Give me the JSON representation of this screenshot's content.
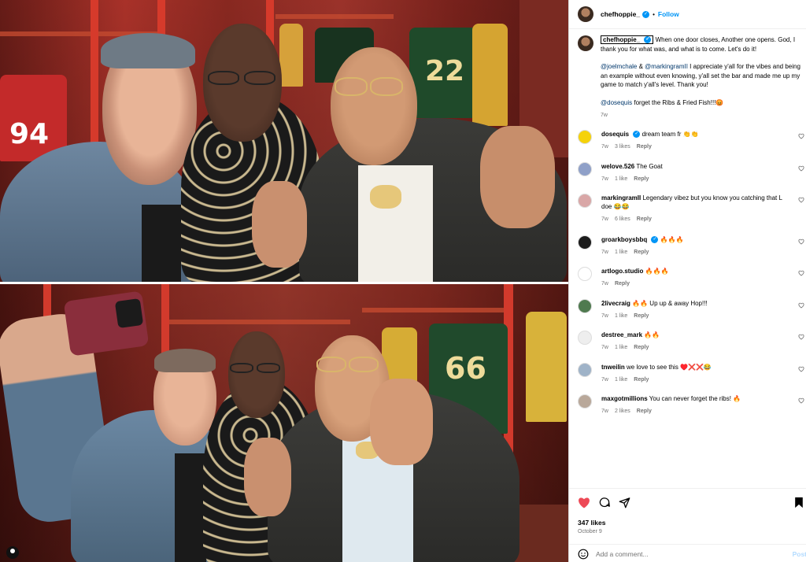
{
  "post": {
    "author": "chefhoppie_",
    "follow_label": "Follow",
    "separator": "•",
    "caption": {
      "lines": [
        "When one door closes, Another one opens. God, I thank you for what was, and what is to come. Let's do it!"
      ],
      "para2_mention1": "@joelmchale",
      "para2_amp": " & ",
      "para2_mention2": "@markingramII",
      "para2_text": " I appreciate y'all for the vibes and being an example without even knowing, y'all set the bar and made me up my game to match y'all's level. Thank you!",
      "para3_mention": "@dosequis",
      "para3_text": " forget the Ribs & Fried Fish!!!😡",
      "time": "7w"
    },
    "likes": "347 likes",
    "date": "October 9",
    "add_comment_placeholder": "Add a comment...",
    "post_label": "Post"
  },
  "comments": [
    {
      "user": "dosequis",
      "verified": true,
      "text": "dream team fr 👏👏",
      "time": "7w",
      "likes": "3 likes",
      "reply": "Reply",
      "avatar_color": "#f5d20a"
    },
    {
      "user": "welove.526",
      "verified": false,
      "text": "The Goat",
      "time": "7w",
      "likes": "1 like",
      "reply": "Reply",
      "avatar_color": "#8fa0c8"
    },
    {
      "user": "markingramII",
      "verified": false,
      "text": "Legendary vibez but you know you catching that L doe 😂😂",
      "time": "7w",
      "likes": "6 likes",
      "reply": "Reply",
      "avatar_color": "#d9a7a7"
    },
    {
      "user": "groarkboysbbq",
      "verified": true,
      "text": "🔥🔥🔥",
      "time": "7w",
      "likes": "1 like",
      "reply": "Reply",
      "avatar_color": "#1c1c1c"
    },
    {
      "user": "artlogo.studio",
      "verified": false,
      "text": "🔥🔥🔥",
      "time": "7w",
      "likes": "",
      "reply": "Reply",
      "avatar_color": "#ffffff"
    },
    {
      "user": "2livecraig",
      "verified": false,
      "text": "🔥🔥 Up up & away Hop!!!",
      "time": "7w",
      "likes": "1 like",
      "reply": "Reply",
      "avatar_color": "#4f7a4f"
    },
    {
      "user": "destree_mark",
      "verified": false,
      "text": "🔥🔥",
      "time": "7w",
      "likes": "1 like",
      "reply": "Reply",
      "avatar_color": "#eeeeee"
    },
    {
      "user": "tnweilin",
      "verified": false,
      "text": "we love to see this ♥️❌❌😂",
      "time": "7w",
      "likes": "1 like",
      "reply": "Reply",
      "avatar_color": "#9fb3c8"
    },
    {
      "user": "maxgotmillions",
      "verified": false,
      "text": "You can never forget the ribs! 🔥",
      "time": "7w",
      "likes": "2 likes",
      "reply": "Reply",
      "avatar_color": "#b9a89a"
    }
  ],
  "colors": {
    "accent": "#0095f6",
    "like_red": "#ed4956",
    "secondary_text": "#737373"
  },
  "icons": [
    "heart-icon",
    "comment-icon",
    "share-icon",
    "bookmark-icon",
    "emoji-icon",
    "verified-icon"
  ],
  "media": {
    "jersey_numbers": [
      "22",
      "66",
      "94"
    ]
  }
}
